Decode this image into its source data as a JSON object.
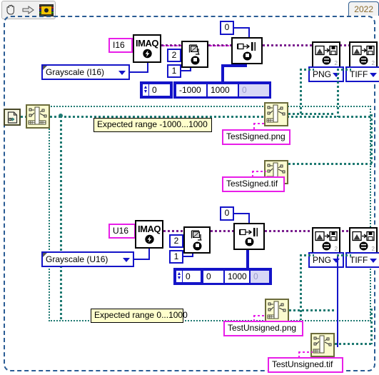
{
  "window": {
    "version_label": "2022",
    "toolbar": {
      "items": [
        {
          "name": "hand-tool-icon",
          "label": "hand-tool"
        },
        {
          "name": "arrow-tool-icon",
          "label": "arrow-tool"
        },
        {
          "name": "vi-icon",
          "label": "vi-icon"
        }
      ]
    }
  },
  "signed_section": {
    "type_constant": "I16",
    "imaq_label": "IMAQ",
    "image_type_enum": "Grayscale (I16)",
    "setup_const_top": "2",
    "setup_const_bottom": "1",
    "offset_constant": "0",
    "array_index": "0",
    "array_values": [
      "-1000",
      "1000",
      "0"
    ],
    "range_note": "Expected range -1000...1000",
    "png_format": "PNG",
    "tiff_format": "TIFF",
    "png_sub": "2",
    "tiff_sub": "2",
    "png_filename": "TestSigned.png",
    "tif_filename": "TestSigned.tif"
  },
  "unsigned_section": {
    "type_constant": "U16",
    "imaq_label": "IMAQ",
    "image_type_enum": "Grayscale (U16)",
    "setup_const_top": "2",
    "setup_const_bottom": "1",
    "offset_constant": "0",
    "array_index": "0",
    "array_values": [
      "0",
      "1000",
      "0"
    ],
    "range_note": "Expected range 0...1000",
    "png_format": "PNG",
    "tiff_format": "TIFF",
    "png_sub": "2",
    "tiff_sub": "2",
    "png_filename": "TestUnsigned.png",
    "tif_filename": "TestUnsigned.tif"
  },
  "path_source": {
    "file_dialog_icon": "file-path-icon",
    "build_path_icon": "build-path-icon"
  },
  "colors": {
    "wire_image": "#7b1f8f",
    "wire_numeric": "#1414c8",
    "wire_path": "#1f7a72",
    "constant_pink": "#e81ee8",
    "frame_blue": "#2a5c94",
    "label_yellow": "#ffffcc"
  }
}
